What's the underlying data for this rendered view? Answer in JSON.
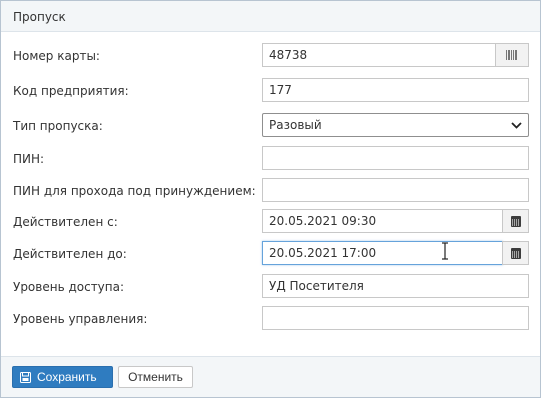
{
  "header": {
    "title": "Пропуск"
  },
  "form": {
    "card_number": {
      "label": "Номер карты:",
      "value": "48738",
      "addon_icon": "barcode-icon"
    },
    "company_code": {
      "label": "Код предприятия:",
      "value": "177"
    },
    "pass_type": {
      "label": "Тип пропуска:",
      "value": "Разовый"
    },
    "pin": {
      "label": "ПИН:",
      "value": ""
    },
    "duress_pin": {
      "label": "ПИН для прохода под принуждением:",
      "value": ""
    },
    "valid_from": {
      "label": "Действителен с:",
      "value": "20.05.2021 09:30",
      "addon_icon": "calendar-icon"
    },
    "valid_to": {
      "label": "Действителен до:",
      "value": "20.05.2021 17:00",
      "addon_icon": "calendar-icon"
    },
    "access_level": {
      "label": "Уровень доступа:",
      "value": "УД Посетителя"
    },
    "control_level": {
      "label": "Уровень управления:",
      "value": ""
    }
  },
  "footer": {
    "save_label": "Сохранить",
    "save_icon": "floppy-disk-icon",
    "cancel_label": "Отменить"
  },
  "colors": {
    "accent": "#2f7cc0",
    "focus_border": "#66a3db",
    "panel_bg": "#f3f6f8"
  }
}
